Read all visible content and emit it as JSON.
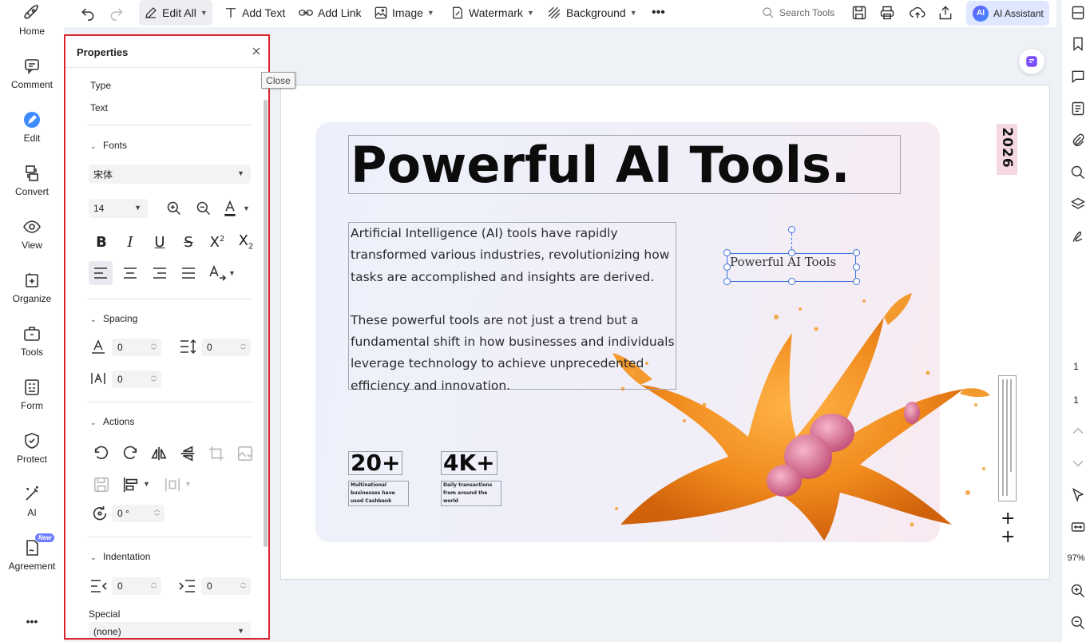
{
  "left_rail": {
    "items": [
      {
        "label": "Home",
        "icon": "rocket-icon"
      },
      {
        "label": "Comment",
        "icon": "comment-icon"
      },
      {
        "label": "Edit",
        "icon": "edit-pen-icon"
      },
      {
        "label": "Convert",
        "icon": "convert-icon"
      },
      {
        "label": "View",
        "icon": "eye-icon"
      },
      {
        "label": "Organize",
        "icon": "organize-icon"
      },
      {
        "label": "Tools",
        "icon": "toolbox-icon"
      },
      {
        "label": "Form",
        "icon": "form-icon"
      },
      {
        "label": "Protect",
        "icon": "shield-icon"
      },
      {
        "label": "AI",
        "icon": "magic-wand-icon"
      },
      {
        "label": "Agreement",
        "icon": "agreement-icon"
      }
    ],
    "new_badge": "New",
    "more": "•••"
  },
  "toolbar": {
    "edit_all": "Edit All",
    "add_text": "Add Text",
    "add_link": "Add Link",
    "image": "Image",
    "watermark": "Watermark",
    "background": "Background",
    "more": "•••",
    "search_placeholder": "Search Tools",
    "ai_assistant": "AI Assistant",
    "ai_badge": "AI"
  },
  "properties": {
    "title": "Properties",
    "close_tooltip": "Close",
    "type_label": "Type",
    "type_value": "Text",
    "fonts_label": "Fonts",
    "font_family": "宋体",
    "font_size": "14",
    "spacing_label": "Spacing",
    "char_spacing": "0",
    "line_spacing": "0",
    "word_spacing": "0",
    "actions_label": "Actions",
    "rotation": "0 °",
    "indentation_label": "Indentation",
    "indent_left": "0",
    "indent_right": "0",
    "special_label": "Special",
    "special_value": "(none)"
  },
  "document": {
    "headline": "Powerful AI Tools.",
    "paragraph1": "Artificial Intelligence (AI) tools have rapidly transformed various industries, revolutionizing how tasks are accomplished and insights are derived.",
    "paragraph2": "These powerful tools are not just a trend but a fundamental shift in how businesses and individuals leverage technology to achieve unprecedented efficiency and innovation.",
    "year": "2026",
    "selected_text": "Powerful AI Tools",
    "stat1_value": "20+",
    "stat1_caption": "Multinational businesses have used Cashbank",
    "stat2_value": "4K+",
    "stat2_caption": "Daily transactions from around the world",
    "plus": "+"
  },
  "right_rail": {
    "page_current": "1",
    "page_total": "1",
    "zoom": "97%"
  },
  "colors": {
    "accent": "#3b6fdc",
    "panel_border": "#d8262e",
    "ai_button": "#dfe6ff"
  }
}
